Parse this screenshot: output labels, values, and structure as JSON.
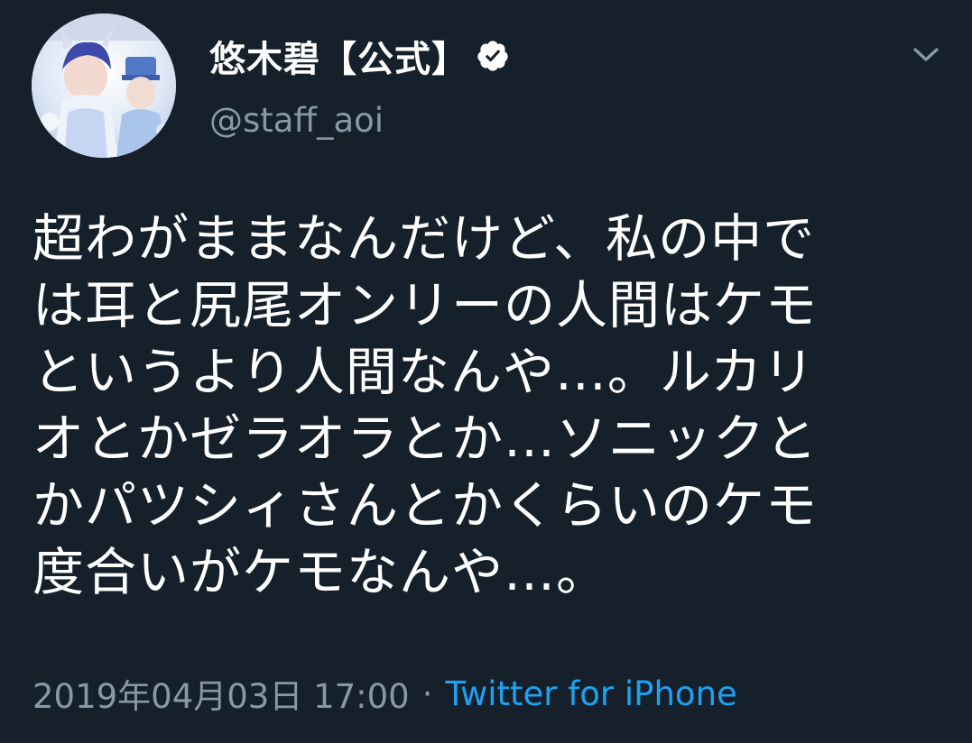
{
  "tweet": {
    "author": {
      "display_name": "悠木碧【公式】",
      "handle": "@staff_aoi",
      "verified": true
    },
    "text_lines": [
      "超わがままなんだけど、私の中で",
      "は耳と尻尾オンリーの人間はケモ",
      "というより人間なんや…。ルカリ",
      "オとかゼラオラとか…ソニックと",
      "かパツシィさんとかくらいのケモ",
      "度合いがケモなんや…。"
    ],
    "timestamp": "2019年04月03日 17:00",
    "separator": "·",
    "source": "Twitter for iPhone"
  },
  "icons": {
    "verified": "verified-badge-icon",
    "menu": "chevron-down-icon"
  },
  "colors": {
    "background": "#15202b",
    "text": "#ffffff",
    "secondary": "#8899a6",
    "accent": "#1da1f2"
  }
}
